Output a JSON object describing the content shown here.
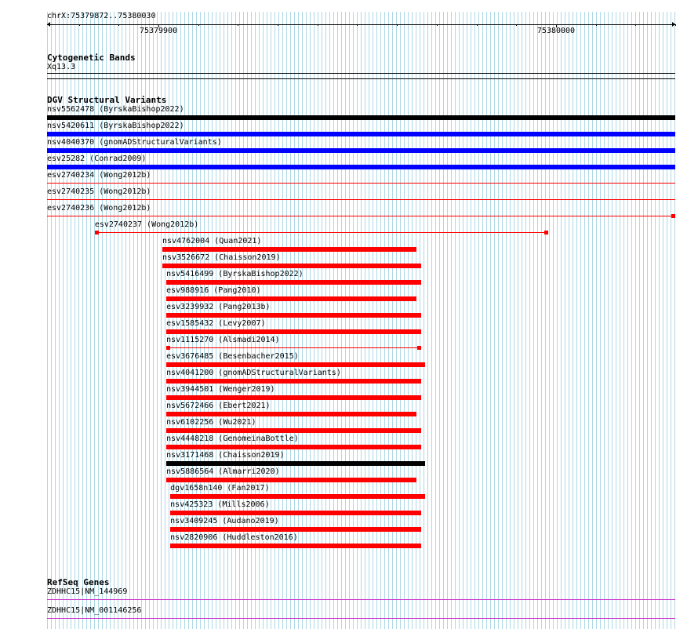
{
  "ruler": {
    "range_label": "chrX:75379872..75380030",
    "ticks": [
      {
        "label": "75379900",
        "pos": 75379900
      },
      {
        "label": "75380000",
        "pos": 75380000
      }
    ],
    "start": 75379872,
    "end": 75380030
  },
  "cytoband": {
    "title": "Cytogenetic Bands",
    "band": "Xq13.3"
  },
  "dgv": {
    "title": "DGV Structural Variants",
    "colors": {
      "black": "#000000",
      "blue": "#0000ff",
      "red": "#ff0000"
    },
    "items": [
      {
        "label": "nsv5562478 (ByrskaBishop2022)",
        "start": 75379872,
        "end": 75380030,
        "color": "black",
        "style": "thick"
      },
      {
        "label": "nsv5420611 (ByrskaBishop2022)",
        "start": 75379872,
        "end": 75380030,
        "color": "blue",
        "style": "thick"
      },
      {
        "label": "nsv4040370 (gnomADStructuralVariants)",
        "start": 75379872,
        "end": 75380030,
        "color": "blue",
        "style": "thick"
      },
      {
        "label": "esv25282 (Conrad2009)",
        "start": 75379872,
        "end": 75380030,
        "color": "blue",
        "style": "thick"
      },
      {
        "label": "esv2740234 (Wong2012b)",
        "start": 75379872,
        "end": 75380030,
        "color": "red",
        "style": "thin"
      },
      {
        "label": "esv2740235 (Wong2012b)",
        "start": 75379872,
        "end": 75380030,
        "color": "red",
        "style": "thin"
      },
      {
        "label": "esv2740236 (Wong2012b)",
        "start": 75379872,
        "end": 75380030,
        "color": "red",
        "style": "thin-endcap"
      },
      {
        "label": "esv2740237 (Wong2012b)",
        "start": 75379884,
        "end": 75379998,
        "color": "red",
        "style": "capped"
      },
      {
        "label": "nsv4762004 (Quan2021)",
        "start": 75379901,
        "end": 75379965,
        "color": "red",
        "style": "thick"
      },
      {
        "label": "nsv3526672 (Chaisson2019)",
        "start": 75379901,
        "end": 75379966,
        "color": "red",
        "style": "thick"
      },
      {
        "label": "nsv5416499 (ByrskaBishop2022)",
        "start": 75379902,
        "end": 75379966,
        "color": "red",
        "style": "thick"
      },
      {
        "label": "esv988916 (Pang2010)",
        "start": 75379902,
        "end": 75379965,
        "color": "red",
        "style": "thick"
      },
      {
        "label": "esv3239932 (Pang2013b)",
        "start": 75379902,
        "end": 75379966,
        "color": "red",
        "style": "thick"
      },
      {
        "label": "esv1585432 (Levy2007)",
        "start": 75379902,
        "end": 75379966,
        "color": "red",
        "style": "thick"
      },
      {
        "label": "nsv1115270 (Alsmadi2014)",
        "start": 75379902,
        "end": 75379966,
        "color": "red",
        "style": "capped"
      },
      {
        "label": "esv3676485 (Besenbacher2015)",
        "start": 75379902,
        "end": 75379967,
        "color": "red",
        "style": "thick"
      },
      {
        "label": "nsv4041200 (gnomADStructuralVariants)",
        "start": 75379902,
        "end": 75379966,
        "color": "red",
        "style": "thick"
      },
      {
        "label": "nsv3944501 (Wenger2019)",
        "start": 75379902,
        "end": 75379966,
        "color": "red",
        "style": "thick"
      },
      {
        "label": "nsv5672466 (Ebert2021)",
        "start": 75379902,
        "end": 75379965,
        "color": "red",
        "style": "thick"
      },
      {
        "label": "nsv6102256 (Wu2021)",
        "start": 75379902,
        "end": 75379966,
        "color": "red",
        "style": "thick"
      },
      {
        "label": "nsv4448218 (GenomeinaBottle)",
        "start": 75379902,
        "end": 75379966,
        "color": "red",
        "style": "thick"
      },
      {
        "label": "nsv3171468 (Chaisson2019)",
        "start": 75379902,
        "end": 75379967,
        "color": "black",
        "style": "thick"
      },
      {
        "label": "nsv5886564 (Almarri2020)",
        "start": 75379902,
        "end": 75379965,
        "color": "red",
        "style": "thick"
      },
      {
        "label": "dgv1658n140 (Fan2017)",
        "start": 75379903,
        "end": 75379967,
        "color": "red",
        "style": "thick"
      },
      {
        "label": "nsv425323 (Mills2006)",
        "start": 75379903,
        "end": 75379966,
        "color": "red",
        "style": "thick"
      },
      {
        "label": "nsv3409245 (Audano2019)",
        "start": 75379903,
        "end": 75379966,
        "color": "red",
        "style": "thick"
      },
      {
        "label": "nsv2820906 (Huddleston2016)",
        "start": 75379903,
        "end": 75379966,
        "color": "red",
        "style": "thick"
      }
    ]
  },
  "refseq": {
    "title": "RefSeq Genes",
    "color": "#cc33cc",
    "items": [
      {
        "label": "ZDHHC15|NM_144969"
      },
      {
        "label": "ZDHHC15|NM_001146256"
      }
    ]
  },
  "grid_color": "#aed8e6"
}
